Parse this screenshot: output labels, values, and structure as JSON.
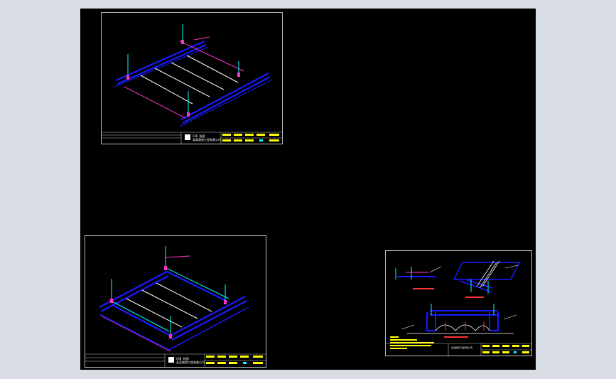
{
  "colors": {
    "background": "#000000",
    "frame": "#bdbdbd",
    "blue": "#1a1aff",
    "magenta": "#ff33cc",
    "cyan": "#00ffff",
    "white": "#ffffff",
    "yellow": "#ffff00",
    "red": "#ff3333",
    "app_bg": "#d8dde3"
  },
  "sheets": [
    {
      "name": "sheet-top-left",
      "title_block": {
        "drawing_title": "CAD 绘图",
        "company": "某某装饰工程有限公司"
      }
    },
    {
      "name": "sheet-bottom-left",
      "title_block": {
        "drawing_title": "CAD 绘图",
        "company": "某某装饰工程有限公司"
      }
    },
    {
      "name": "sheet-detail",
      "title_block": {
        "company": "某某装饰工程有限公司"
      }
    }
  ]
}
